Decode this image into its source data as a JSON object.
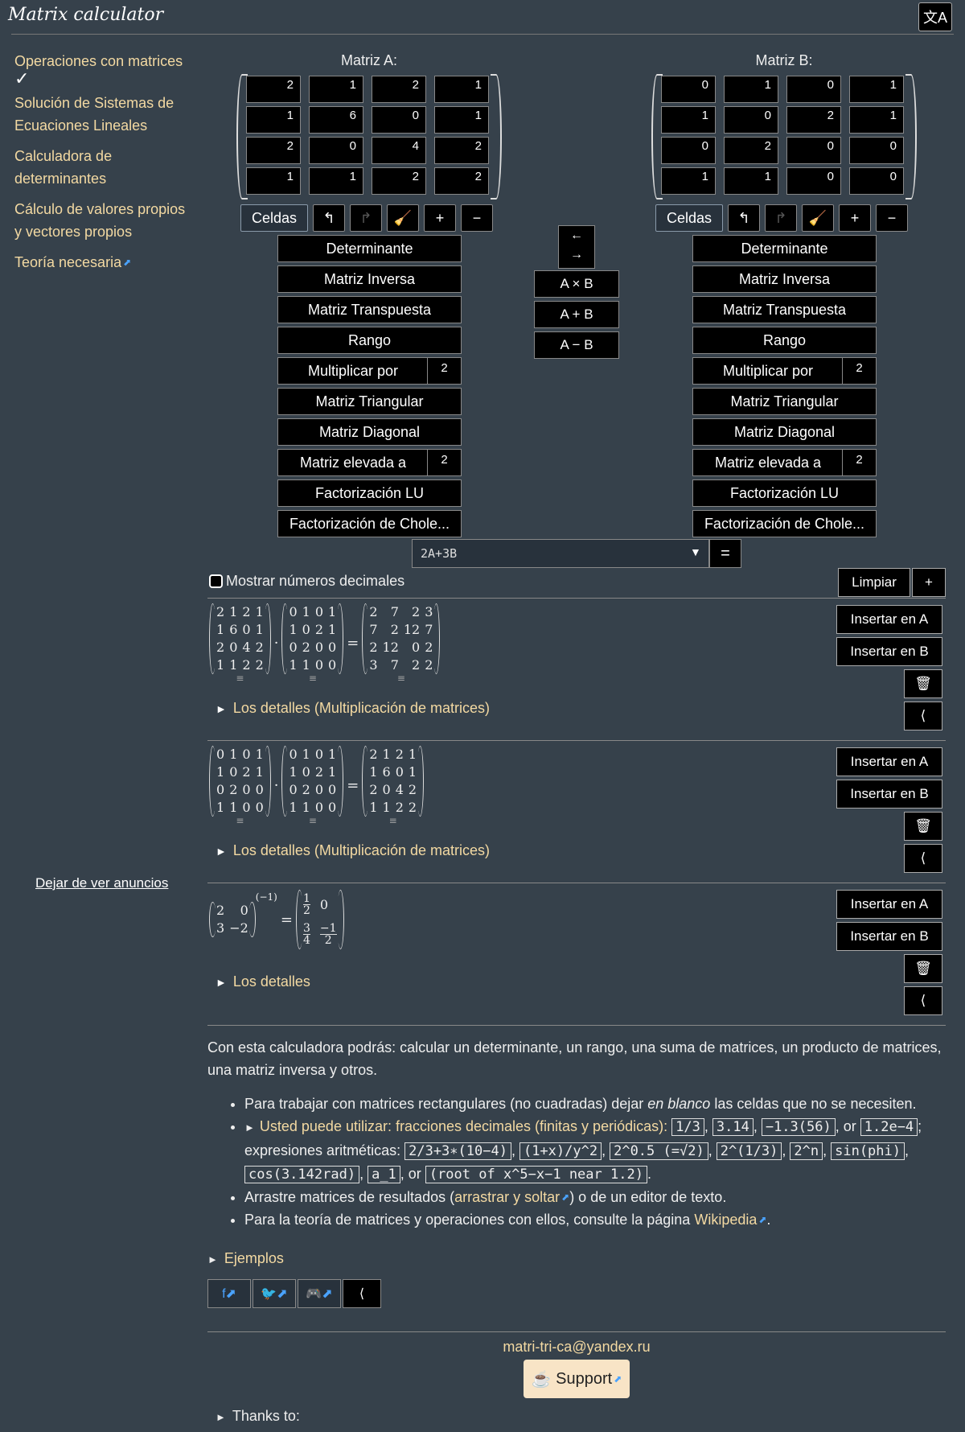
{
  "header": {
    "title": "Matrix calculator",
    "lang_icon": "translate-icon"
  },
  "sidebar": {
    "items": [
      {
        "label": "Operaciones con matrices",
        "mark": "✓"
      },
      {
        "label": "Solución de Sistemas de Ecuaciones Lineales"
      },
      {
        "label": "Calculadora de determinantes"
      },
      {
        "label": "Cálculo de valores propios y vectores propios"
      },
      {
        "label": "Teoría necesaria"
      }
    ],
    "ads_link": "Dejar de ver anuncios"
  },
  "matrixA": {
    "label": "Matriz A:",
    "cells": [
      "2",
      "1",
      "2",
      "1",
      "1",
      "6",
      "0",
      "1",
      "2",
      "0",
      "4",
      "2",
      "1",
      "1",
      "2",
      "2"
    ]
  },
  "matrixB": {
    "label": "Matriz B:",
    "cells": [
      "0",
      "1",
      "0",
      "1",
      "1",
      "0",
      "2",
      "1",
      "0",
      "2",
      "0",
      "0",
      "1",
      "1",
      "0",
      "0"
    ]
  },
  "toolbar": {
    "cells_label": "Celdas",
    "plus": "+",
    "minus": "−"
  },
  "ops": {
    "determinant": "Determinante",
    "inverse": "Matriz Inversa",
    "transpose": "Matriz Transpuesta",
    "rank": "Rango",
    "multiply": "Multiplicar por",
    "multiply_value": "2",
    "triangular": "Matriz Triangular",
    "diagonal": "Matriz Diagonal",
    "power": "Matriz elevada a",
    "power_value": "2",
    "lu": "Factorización LU",
    "cholesky": "Factorización de Chole..."
  },
  "middle": {
    "swap_top": "←",
    "swap_bottom": "→",
    "axb": "A × B",
    "apb": "A + B",
    "amb": "A − B"
  },
  "expression": {
    "value": "2A+3B",
    "eq": "="
  },
  "decimals": {
    "label": "Mostrar números decimales"
  },
  "controls": {
    "clear": "Limpiar",
    "add": "+"
  },
  "results": [
    {
      "left": [
        [
          "2",
          "1",
          "2",
          "1"
        ],
        [
          "1",
          "6",
          "0",
          "1"
        ],
        [
          "2",
          "0",
          "4",
          "2"
        ],
        [
          "1",
          "1",
          "2",
          "2"
        ]
      ],
      "right": [
        [
          "0",
          "1",
          "0",
          "1"
        ],
        [
          "1",
          "0",
          "2",
          "1"
        ],
        [
          "0",
          "2",
          "0",
          "0"
        ],
        [
          "1",
          "1",
          "0",
          "0"
        ]
      ],
      "result": [
        [
          "2",
          "7",
          "2",
          "3"
        ],
        [
          "7",
          "2",
          "12",
          "7"
        ],
        [
          "2",
          "12",
          "0",
          "2"
        ],
        [
          "3",
          "7",
          "2",
          "2"
        ]
      ],
      "details": "Los detalles (Multiplicación de matrices)"
    },
    {
      "left": [
        [
          "0",
          "1",
          "0",
          "1"
        ],
        [
          "1",
          "0",
          "2",
          "1"
        ],
        [
          "0",
          "2",
          "0",
          "0"
        ],
        [
          "1",
          "1",
          "0",
          "0"
        ]
      ],
      "right": [
        [
          "0",
          "1",
          "0",
          "1"
        ],
        [
          "1",
          "0",
          "2",
          "1"
        ],
        [
          "0",
          "2",
          "0",
          "0"
        ],
        [
          "1",
          "1",
          "0",
          "0"
        ]
      ],
      "result": [
        [
          "2",
          "1",
          "2",
          "1"
        ],
        [
          "1",
          "6",
          "0",
          "1"
        ],
        [
          "2",
          "0",
          "4",
          "2"
        ],
        [
          "1",
          "1",
          "2",
          "2"
        ]
      ],
      "details": "Los detalles (Multiplicación de matrices)"
    },
    {
      "left": [
        [
          "2",
          "0"
        ],
        [
          "3",
          "−2"
        ]
      ],
      "exponent": "(−1)",
      "result": [
        [
          "1",
          "2",
          "0"
        ],
        [
          "3",
          "4",
          "−1",
          "2"
        ]
      ],
      "details": "Los detalles"
    }
  ],
  "result_buttons": {
    "insert_a": "Insertar en A",
    "insert_b": "Insertar en B"
  },
  "info": {
    "intro": "Con esta calculadora podrás: calcular un determinante, un rango, una suma de matrices, un producto de matrices, una matriz inversa y otros.",
    "b1_pre": "Para trabajar con matrices rectangulares (no cuadradas) dejar ",
    "b1_em": "en blanco",
    "b1_post": " las celdas que no se necesiten.",
    "b2_link": "Usted puede utilizar: fracciones decimales (finitas y periódicas):",
    "codes1": [
      "1/3",
      "3.14",
      "−1.3(56)"
    ],
    "or": ", or",
    "code_e": "1.2e−4",
    "b2_mid": "; expresiones aritméticas:",
    "codes2": [
      "2/3+3∗(10−4)",
      "(1+x)/y^2",
      "2^0.5 (=√2)",
      "2^(1/3)",
      "2^n",
      "sin(phi)",
      "cos(3.142rad)",
      "a_1",
      "(root of x^5−x−1 near 1.2)"
    ],
    "b3_pre": "Arrastre matrices de resultados (",
    "b3_link": "arrastrar y soltar",
    "b3_post": ") o de un editor de texto.",
    "b4_pre": "Para la teoría de matrices y operaciones con ellos, consulte la página ",
    "b4_link": "Wikipedia",
    "b4_post": ".",
    "examples": "Ejemplos"
  },
  "footer": {
    "email": "matri-tri-ca@yandex.ru",
    "support": "Support",
    "support_icon": "☕",
    "thanks": "Thanks to:"
  }
}
